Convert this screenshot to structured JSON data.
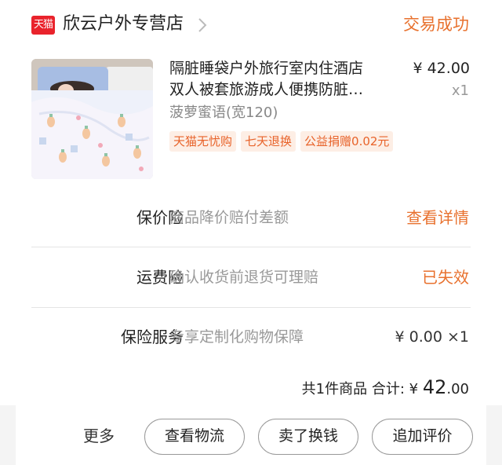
{
  "shop": {
    "badge": "天猫",
    "name": "欣云户外专营店",
    "status": "交易成功"
  },
  "product": {
    "title_line1": "隔脏睡袋户外旅行室内住酒店",
    "title_line2": "双人被套旅游成人便携防脏…",
    "price": "¥ 42.00",
    "quantity": "x1",
    "sku": "菠萝蜜语(宽120)",
    "tags": [
      "天猫无忧购",
      "七天退换",
      "公益捐赠0.02元"
    ]
  },
  "services": [
    {
      "label": "保价险",
      "desc": "商品降价赔付差额",
      "action": "查看详情"
    },
    {
      "label": "运费险",
      "desc": "确认收货前退货可理赔",
      "action": "已失效"
    },
    {
      "label": "保险服务",
      "desc": "专享定制化购物保障",
      "price": "¥ 0.00 ×1"
    }
  ],
  "summary": {
    "prefix": "共1件商品 合计: ¥ ",
    "total_int": "42",
    "total_dec": ".00"
  },
  "actions": {
    "more": "更多",
    "buttons": [
      "查看物流",
      "卖了换钱",
      "追加评价"
    ]
  },
  "colors": {
    "accent": "#e8712e",
    "tmall_red": "#e9232c",
    "tag_bg": "#fdeee5"
  },
  "icons": {
    "shop_arrow": "chevron-right-icon",
    "tmall": "tmall-logo-icon"
  }
}
